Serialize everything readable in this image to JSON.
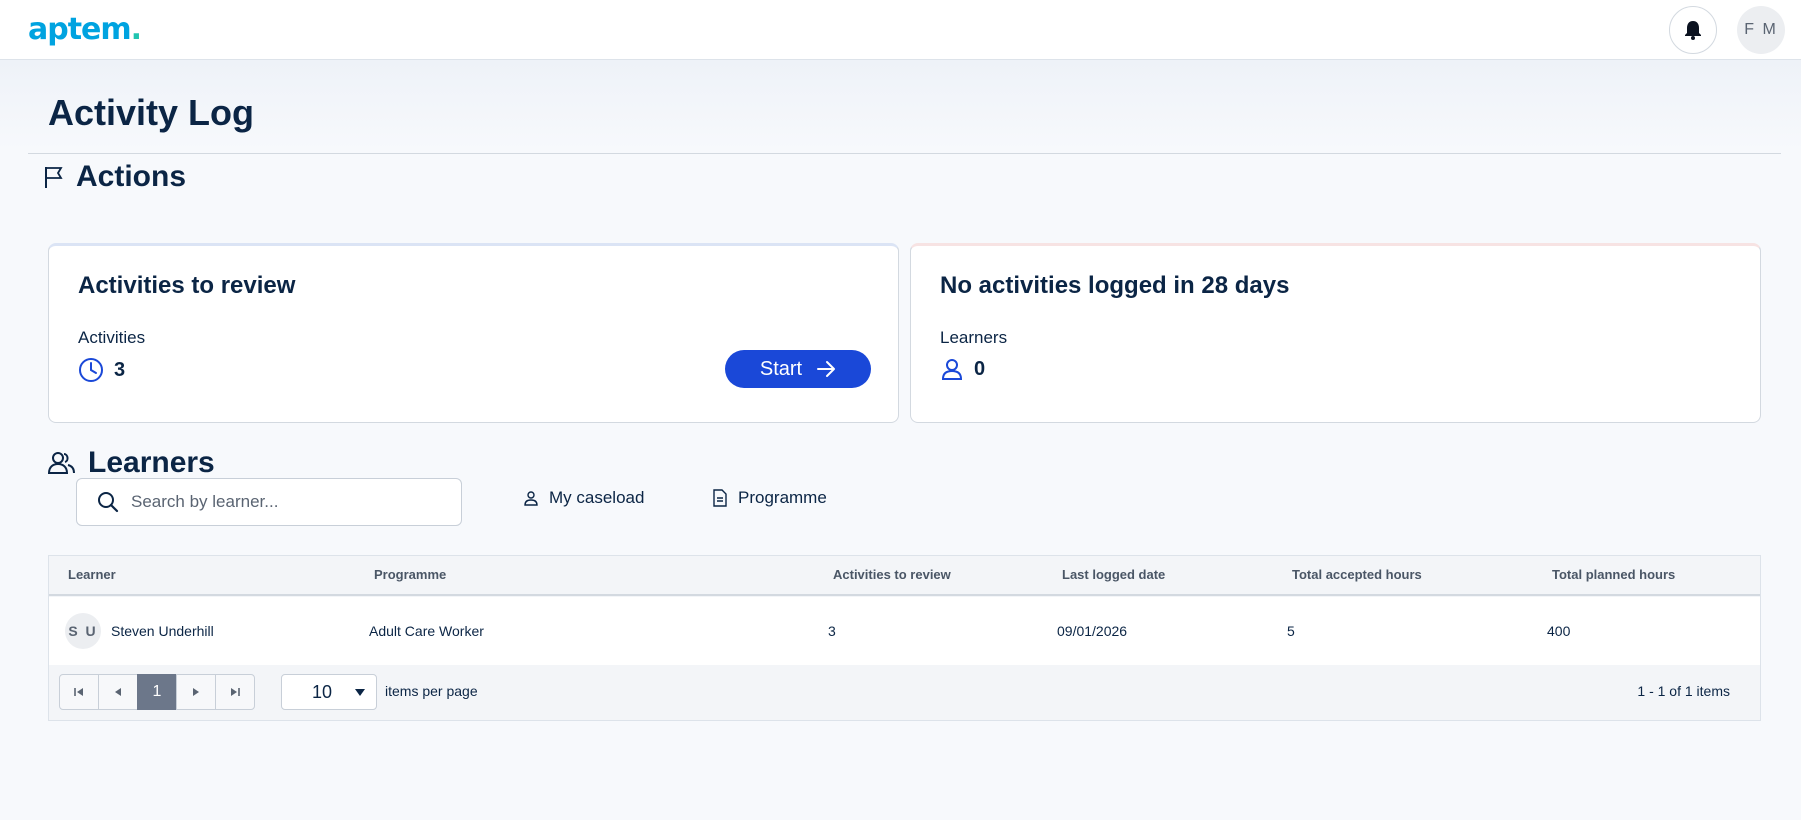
{
  "header": {
    "logo_text": "aptem",
    "logo_dot": ".",
    "avatar_initials": "F M",
    "icons": [
      "bell-icon"
    ]
  },
  "page": {
    "title": "Activity Log"
  },
  "actions": {
    "heading": "Actions",
    "cards": [
      {
        "title": "Activities to review",
        "label": "Activities",
        "value": "3",
        "icon": "clock-icon",
        "button_label": "Start"
      },
      {
        "title": "No activities logged in 28 days",
        "label": "Learners",
        "value": "0",
        "icon": "person-icon"
      }
    ]
  },
  "learners": {
    "heading": "Learners",
    "search_placeholder": "Search by learner...",
    "filters": [
      "My caseload",
      "Programme"
    ],
    "table": {
      "columns": [
        "Learner",
        "Programme",
        "Activities to review",
        "Last logged date",
        "Total accepted hours",
        "Total planned hours"
      ],
      "rows": [
        {
          "initials": "S U",
          "learner": "Steven Underhill",
          "programme": "Adult Care Worker",
          "activities_to_review": "3",
          "last_logged_date": "09/01/2026",
          "total_accepted_hours": "5",
          "total_planned_hours": "400"
        }
      ]
    },
    "pagination": {
      "current_page": "1",
      "page_size": "10",
      "page_size_label": "items per page",
      "items_info": "1 - 1 of 1 items"
    }
  },
  "colors": {
    "brand_blue": "#00a3e0",
    "primary_button": "#1a48d8",
    "text_dark": "#0b2545"
  }
}
